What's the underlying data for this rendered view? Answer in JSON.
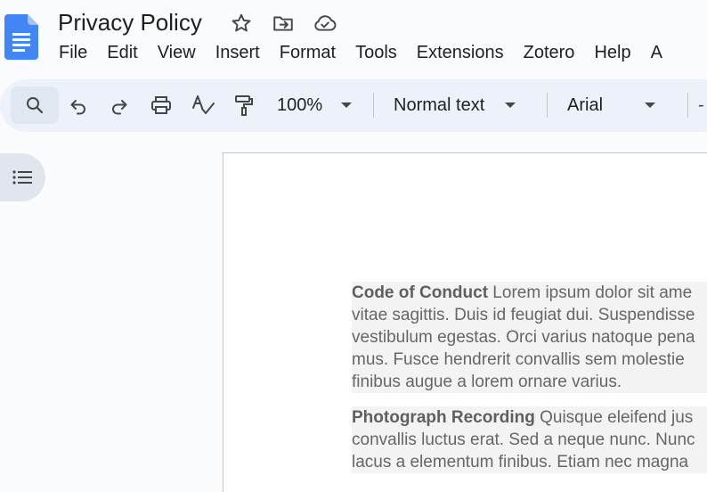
{
  "document": {
    "title": "Privacy Policy"
  },
  "menu": {
    "items": [
      "File",
      "Edit",
      "View",
      "Insert",
      "Format",
      "Tools",
      "Extensions",
      "Zotero",
      "Help",
      "A"
    ]
  },
  "toolbar": {
    "zoom": "100%",
    "style": "Normal text",
    "font": "Arial",
    "minus_label": "-"
  },
  "content": {
    "paragraphs": [
      {
        "heading": "Code of Conduct",
        "lines": [
          " Lorem ipsum dolor sit ame",
          "vitae sagittis. Duis id feugiat dui. Suspendisse",
          "vestibulum egestas. Orci varius natoque pena",
          "mus. Fusce hendrerit convallis sem molestie",
          "finibus augue a lorem ornare varius."
        ]
      },
      {
        "heading": "Photograph Recording",
        "lines": [
          " Quisque eleifend jus",
          "convallis luctus erat. Sed a neque nunc. Nunc",
          "lacus a elementum finibus. Etiam nec magna"
        ]
      }
    ]
  },
  "colors": {
    "docs_blue": "#4285f4",
    "toolbar_bg": "#edf2fa",
    "page_bg": "#ffffff",
    "body_text": "#666666"
  }
}
